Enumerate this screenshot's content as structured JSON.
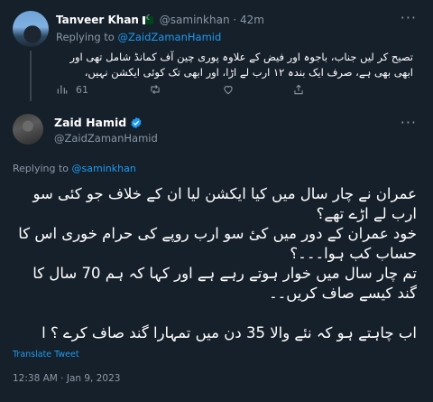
{
  "colors": {
    "background": "#15202b",
    "accent": "#1d9bf0",
    "muted": "#8b98a5",
    "text": "#ffffff"
  },
  "reply_tweet": {
    "name": "Tanveer Khan",
    "flag_icon": "pakistan-flag-icon",
    "handle": "@saminkhan",
    "separator": "·",
    "time": "42m",
    "replying_prefix": "Replying to",
    "replying_to": "@ZaidZamanHamid",
    "text": "تصیح کر لیں جناب، باجوہ اور فیض کے علاوہ پوری چین آف کمانڈ شامل تھی اور ابھی بھی ہے، صرف ایک بندہ ۱۲ ارب لے اڑا، اور ابھی تک کوئی ایکشن نہیں،",
    "views_count": "61"
  },
  "main_tweet": {
    "name": "Zaid Hamid",
    "verified_icon": "verified-badge-icon",
    "handle": "@ZaidZamanHamid",
    "replying_prefix": "Replying to",
    "replying_to": "@saminkhan",
    "text": "عمران نے چار سال میں کیا ایکشن لیا ان کے خلاف جو کئی سو ارب لے اڑے تھے؟\nخود عمران کے دور میں کیٔ سو ارب روپے کی حرام خوری اس کا حساب کب ہوا۔۔۔؟\nتم چار سال میں خوار ہوتے رہے ہے اور کہا کہ ہم 70 سال کا گند کیسے صاف کریں۔۔\n\nاب چاہتے ہو کہ نئے والا 35 دن میں تمہارا گند صاف کرے ؟ ا",
    "translate_label": "Translate Tweet",
    "timestamp": "12:38 AM · Jan 9, 2023"
  }
}
